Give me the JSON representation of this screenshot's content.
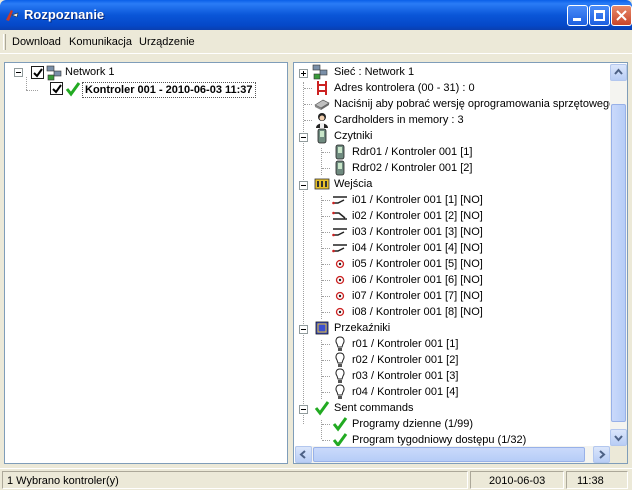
{
  "window": {
    "title": "Rozpoznanie"
  },
  "menu": [
    "Download",
    "Komunikacja",
    "Urządzenie"
  ],
  "left_tree": {
    "network": "Network 1",
    "controller": "Kontroler 001 - 2010-06-03 11:37"
  },
  "right_tree": {
    "network": "Sieć : Network 1",
    "address": "Adres kontrolera (00 - 31) : 0",
    "firmware": "Naciśnij aby pobrać wersję oprogramowania sprzętowego",
    "cardholders": "Cardholders in memory : 3",
    "readers": {
      "label": "Czytniki",
      "items": [
        "Rdr01 / Kontroler 001 [1]",
        "Rdr02 / Kontroler 001 [2]"
      ]
    },
    "inputs": {
      "label": "Wejścia",
      "items": [
        "i01 / Kontroler 001 [1] [NO]",
        "i02 / Kontroler 001 [2] [NO]",
        "i03 / Kontroler 001 [3] [NO]",
        "i04 / Kontroler 001 [4] [NO]",
        "i05 / Kontroler 001 [5] [NO]",
        "i06 / Kontroler 001 [6] [NO]",
        "i07 / Kontroler 001 [7] [NO]",
        "i08 / Kontroler 001 [8] [NO]"
      ]
    },
    "relays": {
      "label": "Przekaźniki",
      "items": [
        "r01 / Kontroler 001 [1]",
        "r02 / Kontroler 001 [2]",
        "r03 / Kontroler 001 [3]",
        "r04 / Kontroler 001 [4]"
      ]
    },
    "sent": {
      "label": "Sent commands",
      "items": [
        "Programy dzienne  (1/99)",
        "Program tygodniowy dostępu  (1/32)"
      ]
    }
  },
  "status": {
    "message": "1 Wybrano kontroler(y)",
    "date": "2010-06-03",
    "time": "11:38"
  },
  "colors": {
    "titlebar": "#0a56d8",
    "check": "#22aa22",
    "selection_border": "#555555"
  }
}
